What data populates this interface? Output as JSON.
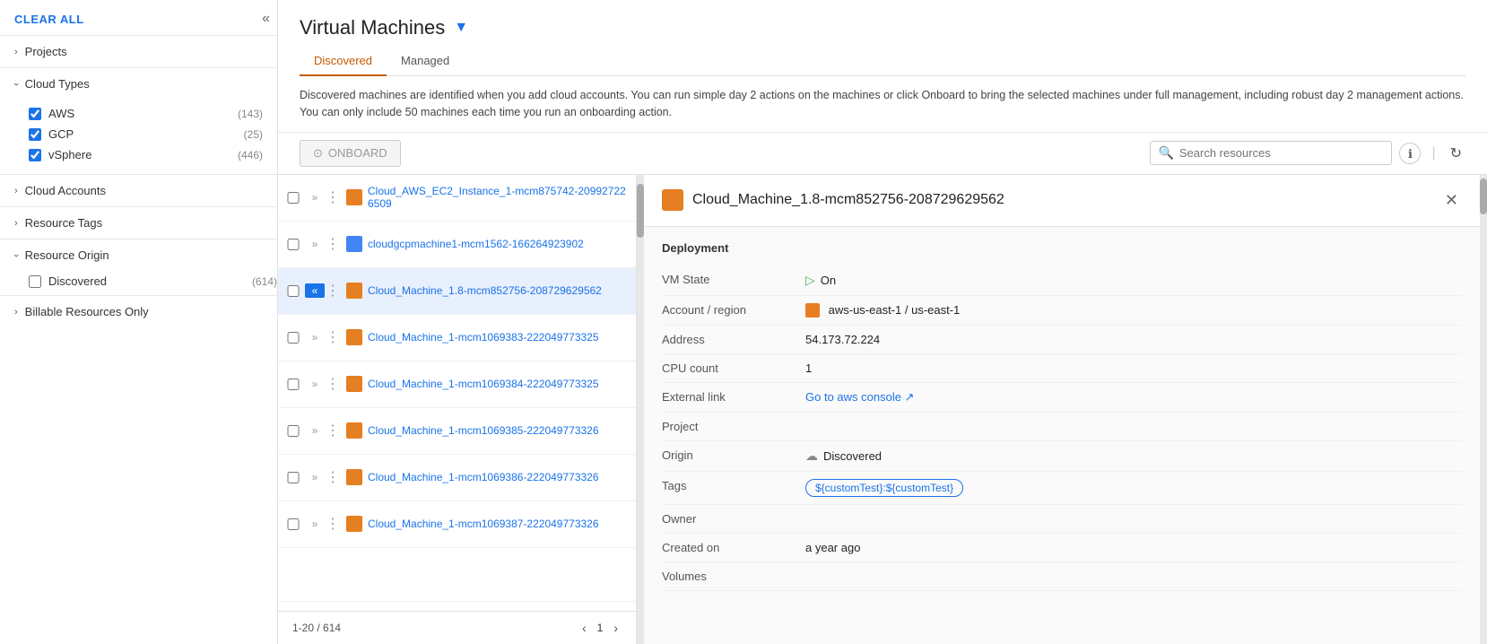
{
  "sidebar": {
    "collapse_icon": "«",
    "clear_all_label": "CLEAR ALL",
    "sections": [
      {
        "id": "projects",
        "label": "Projects",
        "expanded": false,
        "chevron": "›"
      },
      {
        "id": "cloud-types",
        "label": "Cloud Types",
        "expanded": true,
        "chevron": "›",
        "items": [
          {
            "label": "AWS",
            "count": "(143)",
            "checked": true
          },
          {
            "label": "GCP",
            "count": "(25)",
            "checked": true
          },
          {
            "label": "vSphere",
            "count": "(446)",
            "checked": true
          }
        ]
      },
      {
        "id": "cloud-accounts",
        "label": "Cloud Accounts",
        "expanded": false,
        "chevron": "›"
      },
      {
        "id": "resource-tags",
        "label": "Resource Tags",
        "expanded": false,
        "chevron": "›"
      },
      {
        "id": "resource-origin",
        "label": "Resource Origin",
        "expanded": true,
        "chevron": "›"
      }
    ],
    "discovered_filter": {
      "label": "Discovered",
      "count": "(614)",
      "checked": false
    },
    "billable_label": "Billable Resources Only",
    "billable_chevron": "›"
  },
  "page": {
    "title": "Virtual Machines",
    "filter_icon": "▼",
    "tabs": [
      {
        "label": "Discovered",
        "active": true
      },
      {
        "label": "Managed",
        "active": false
      }
    ],
    "description": "Discovered machines are identified when you add cloud accounts. You can run simple day 2 actions on the machines or click Onboard to bring the selected machines under full management, including robust day 2 management actions. You can only include 50 machines each time you run an onboarding action.",
    "onboard_btn": "ONBOARD",
    "search_placeholder": "Search resources",
    "pagination": {
      "range": "1-20 / 614",
      "current_page": "1"
    }
  },
  "table": {
    "rows": [
      {
        "id": 1,
        "name": "Cloud_AWS_EC2_Instance_1-mcm875742-209927226509",
        "type": "aws",
        "selected": false
      },
      {
        "id": 2,
        "name": "cloudgcpmachine1-mcm1562-166264923902",
        "type": "gcp",
        "selected": false
      },
      {
        "id": 3,
        "name": "Cloud_Machine_1.8-mcm852756-208729629562",
        "type": "aws",
        "selected": true
      },
      {
        "id": 4,
        "name": "Cloud_Machine_1-mcm1069383-222049773325",
        "type": "aws",
        "selected": false
      },
      {
        "id": 5,
        "name": "Cloud_Machine_1-mcm1069384-222049773325",
        "type": "aws",
        "selected": false
      },
      {
        "id": 6,
        "name": "Cloud_Machine_1-mcm1069385-222049773326",
        "type": "aws",
        "selected": false
      },
      {
        "id": 7,
        "name": "Cloud_Machine_1-mcm1069386-222049773326",
        "type": "aws",
        "selected": false
      },
      {
        "id": 8,
        "name": "Cloud_Machine_1-mcm1069387-222049773326",
        "type": "aws",
        "selected": false
      }
    ]
  },
  "detail": {
    "title": "Cloud_Machine_1.8-mcm852756-208729629562",
    "section": "Deployment",
    "fields": [
      {
        "label": "VM State",
        "value": "On",
        "type": "vmstate"
      },
      {
        "label": "Account / region",
        "value": "aws-us-east-1 / us-east-1",
        "type": "account"
      },
      {
        "label": "Address",
        "value": "54.173.72.224",
        "type": "text"
      },
      {
        "label": "CPU count",
        "value": "1",
        "type": "text"
      },
      {
        "label": "External link",
        "value": "Go to aws console ↗",
        "type": "link"
      },
      {
        "label": "Project",
        "value": "",
        "type": "text"
      },
      {
        "label": "Origin",
        "value": "Discovered",
        "type": "origin"
      },
      {
        "label": "Tags",
        "value": "${customTest}:${customTest}",
        "type": "tag"
      },
      {
        "label": "Owner",
        "value": "",
        "type": "text"
      },
      {
        "label": "Created on",
        "value": "a year ago",
        "type": "text"
      },
      {
        "label": "Volumes",
        "value": "",
        "type": "text"
      }
    ]
  }
}
